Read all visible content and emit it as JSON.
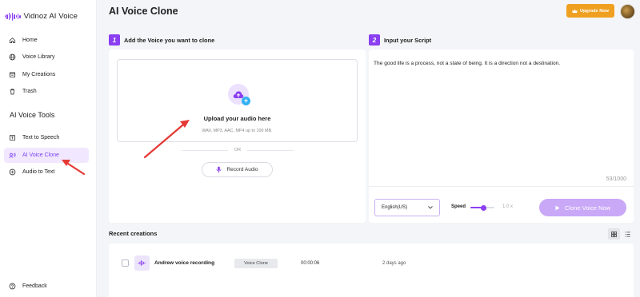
{
  "app": {
    "name": "Vidnoz AI Voice"
  },
  "sidebar": {
    "items": [
      {
        "label": "Home",
        "icon": "home-icon"
      },
      {
        "label": "Voice Library",
        "icon": "globe-icon"
      },
      {
        "label": "My Creations",
        "icon": "folder-icon"
      },
      {
        "label": "Trash",
        "icon": "trash-icon"
      }
    ],
    "tools_title": "AI Voice Tools",
    "tools": [
      {
        "label": "Text to Speech",
        "icon": "speech-icon"
      },
      {
        "label": "AI Voice Clone",
        "icon": "clone-icon",
        "active": true
      },
      {
        "label": "Audio to Text",
        "icon": "audio-text-icon"
      }
    ],
    "feedback": "Feedback"
  },
  "header": {
    "title": "AI Voice Clone",
    "upgrade_label": "Upgrade Now"
  },
  "step1": {
    "number": "1",
    "title": "Add the Voice you want to clone",
    "upload_title": "Upload your audio here",
    "upload_sub": "WAV, MP3, AAC, MP4 up to 100 MB.",
    "or": "OR",
    "record_label": "Record Audio"
  },
  "step2": {
    "number": "2",
    "title": "Input your Script",
    "script": "The good life is a process, not a state of being. It is a direction not a destination.",
    "char_count": "53/1000",
    "language": "English(US)",
    "speed_label": "Speed",
    "speed_value": "1.0 x",
    "speed_level": 0.55,
    "clone_label": "Clone Voice Now"
  },
  "recent": {
    "title": "Recent creations",
    "rows": [
      {
        "name": "Andrew voice recording",
        "type": "Voice Clone",
        "duration": "00:00:06",
        "date": "2 days ago"
      }
    ]
  },
  "colors": {
    "accent": "#8a3ff0",
    "upgrade": "#f0a020",
    "annotation": "#e53935"
  }
}
